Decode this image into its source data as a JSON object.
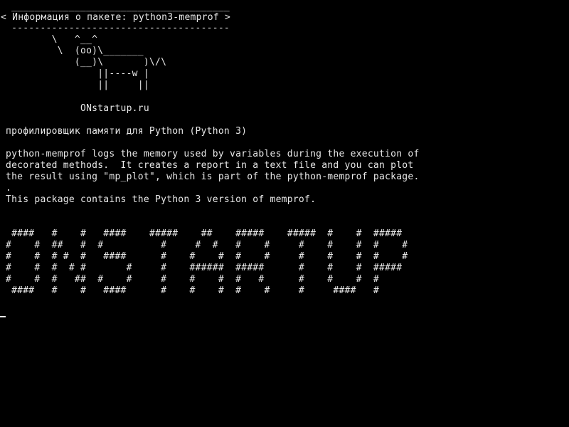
{
  "cowsay": {
    "border_top": " ______________________________________",
    "bubble_text": "< Информация о пакете: python3-memprof >",
    "border_bottom": " --------------------------------------",
    "cow": [
      "        \\   ^__^",
      "         \\  (oo)\\_______",
      "            (__)\\       )\\/\\",
      "                ||----w |",
      "                ||     ||"
    ]
  },
  "site": "             ONstartup.ru",
  "summary": "профилировщик памяти для Python (Python 3)",
  "description": [
    "python-memprof logs the memory used by variables during the execution of",
    "decorated methods.  It creates a report in a text file and you can plot",
    "the result using \"mp_plot\", which is part of the python-memprof package.",
    ".",
    "This package contains the Python 3 version of memprof."
  ],
  "banner": [
    " ####   #    #   ####    #####    ##    #####    #####  #    #  #####",
    "#    #  ##   #  #          #     #  #   #    #     #    #    #  #    #",
    "#    #  # #  #   ####      #    #    #  #    #     #    #    #  #    #",
    "#    #  #  # #       #     #    ######  #####      #    #    #  #####",
    "#    #  #   ##  #    #     #    #    #  #   #      #    #    #  #",
    " ####   #    #   ####      #    #    #  #    #     #     ####   #"
  ]
}
